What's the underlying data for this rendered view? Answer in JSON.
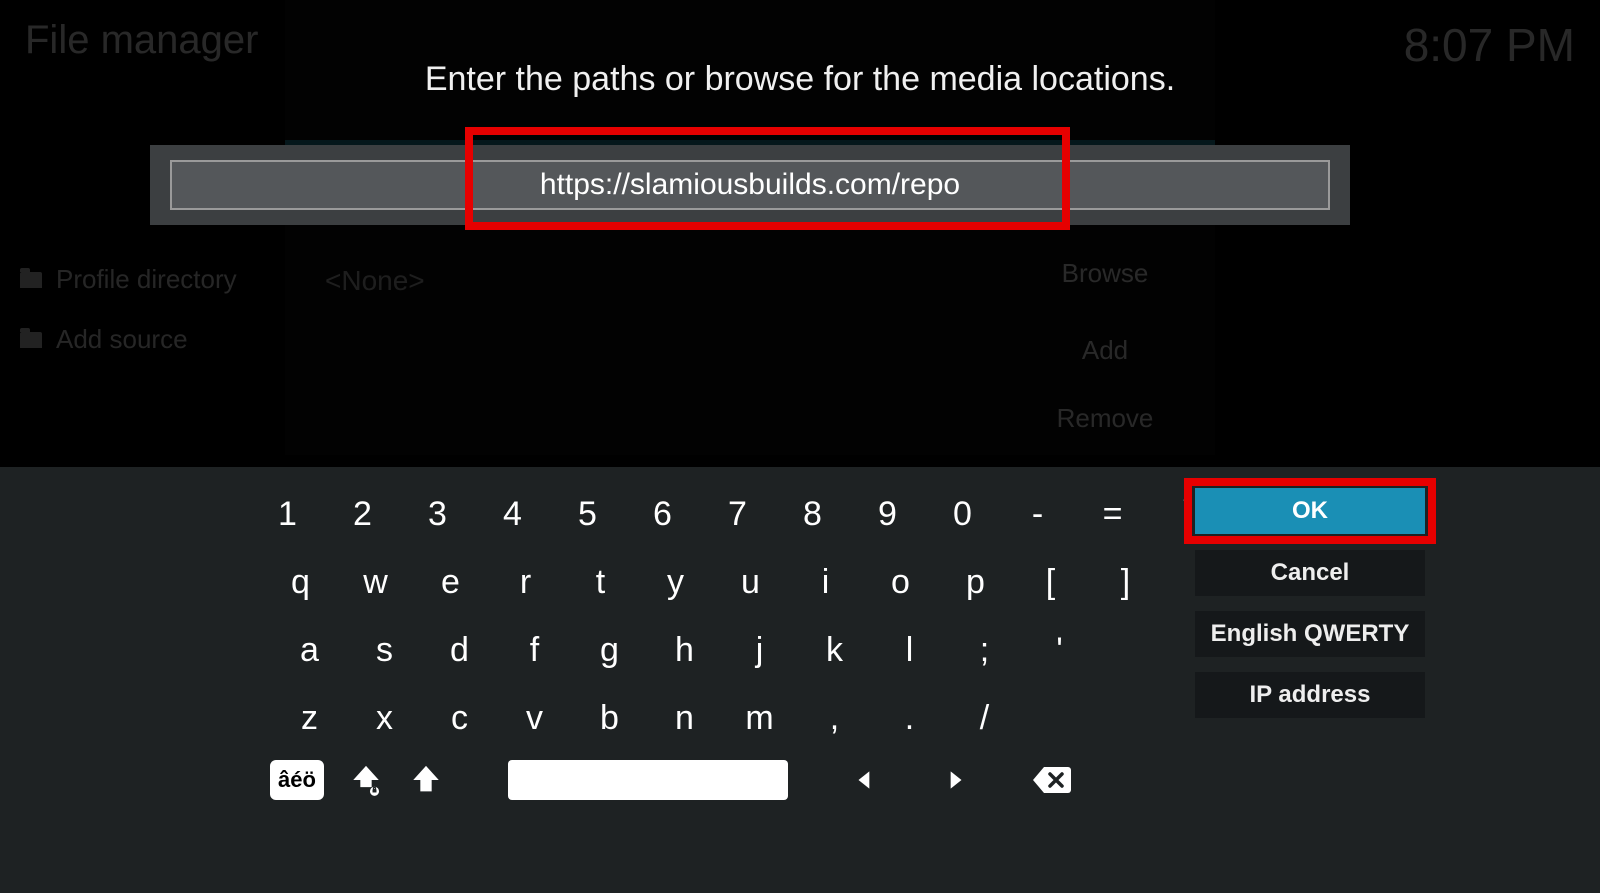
{
  "header": {
    "title": "File manager",
    "clock": "8:07 PM"
  },
  "sidebar": {
    "items": [
      {
        "label": "Profile directory"
      },
      {
        "label": "Add source"
      }
    ]
  },
  "dialog": {
    "prompt": "Enter the paths or browse for the media locations.",
    "input_value": "https://slamiousbuilds.com/repo",
    "none_label": "<None>",
    "browse_label": "Browse",
    "add_label": "Add",
    "remove_label": "Remove"
  },
  "keyboard": {
    "rows": [
      [
        "1",
        "2",
        "3",
        "4",
        "5",
        "6",
        "7",
        "8",
        "9",
        "0",
        "-",
        "=",
        "`"
      ],
      [
        "q",
        "w",
        "e",
        "r",
        "t",
        "y",
        "u",
        "i",
        "o",
        "p",
        "[",
        "]",
        "\\"
      ],
      [
        "a",
        "s",
        "d",
        "f",
        "g",
        "h",
        "j",
        "k",
        "l",
        ";",
        "'"
      ],
      [
        "z",
        "x",
        "c",
        "v",
        "b",
        "n",
        "m",
        ",",
        ".",
        "/"
      ]
    ],
    "accent_label": "âéö"
  },
  "actions": {
    "ok": "OK",
    "cancel": "Cancel",
    "layout": "English QWERTY",
    "ip": "IP address"
  }
}
